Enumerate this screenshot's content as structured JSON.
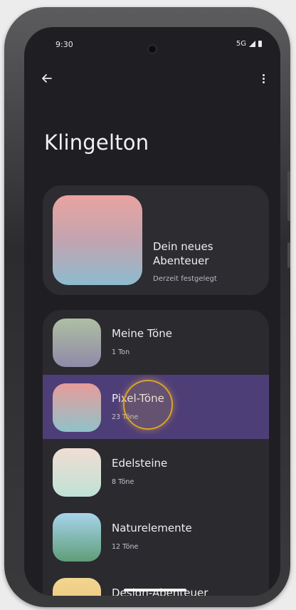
{
  "status_bar": {
    "time": "9:30",
    "network": "5G"
  },
  "toolbar": {
    "back_icon": "arrow-back-icon",
    "menu_icon": "more-vert-icon"
  },
  "page": {
    "title": "Klingelton"
  },
  "current_tone": {
    "name": "Dein neues Abenteuer",
    "status": "Derzeit festgelegt",
    "colors": [
      "#e9a3a0",
      "#8dbbcf"
    ]
  },
  "categories": [
    {
      "name": "Meine Töne",
      "count": "1 Ton",
      "colors": [
        "#aebfa3",
        "#8f8aa8"
      ],
      "selected": false
    },
    {
      "name": "Pixel-Töne",
      "count": "23 Töne",
      "colors": [
        "#e89c9a",
        "#8fc2c9"
      ],
      "selected": true
    },
    {
      "name": "Edelsteine",
      "count": "8 Töne",
      "colors": [
        "#f1ddd3",
        "#bfe2d6"
      ],
      "selected": false
    },
    {
      "name": "Naturelemente",
      "count": "12 Töne",
      "colors": [
        "#a8d4ec",
        "#5f9d78"
      ],
      "selected": false
    },
    {
      "name": "Design-Abenteuer",
      "count": "",
      "colors": [
        "#f2d58f",
        "#e7c079"
      ],
      "selected": false
    }
  ],
  "theme": {
    "selection": "#4e3e78",
    "touch_indicator": "#d9a22c"
  }
}
